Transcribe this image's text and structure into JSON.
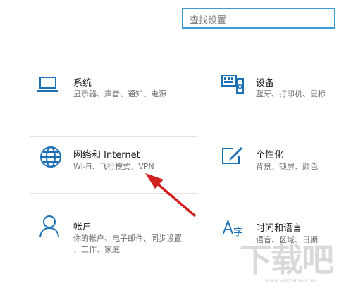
{
  "search": {
    "placeholder": "查找设置"
  },
  "tiles": [
    {
      "title": "系统",
      "desc": [
        "显示器、声音、通知、电源"
      ],
      "icon": "laptop-icon"
    },
    {
      "title": "设备",
      "desc": [
        "蓝牙、打印机、鼠标"
      ],
      "icon": "devices-icon"
    },
    {
      "title": "网络和 Internet",
      "desc": [
        "Wi-Fi、飞行模式、VPN"
      ],
      "icon": "globe-icon"
    },
    {
      "title": "个性化",
      "desc": [
        "背景、锁屏、颜色"
      ],
      "icon": "personalization-icon"
    },
    {
      "title": "帐户",
      "desc": [
        "你的帐户、电子邮件、同步设置",
        "、工作、家庭"
      ],
      "icon": "person-icon"
    },
    {
      "title": "时间和语言",
      "desc": [
        "语音、区域、日期"
      ],
      "icon": "time-language-icon"
    }
  ],
  "watermark": {
    "text": "下载吧",
    "sub": "www.xiazaiba.com"
  },
  "colors": {
    "accent": "#1a6fb5",
    "arrow": "#d11e1e",
    "search_border": "#3d9ad6"
  }
}
